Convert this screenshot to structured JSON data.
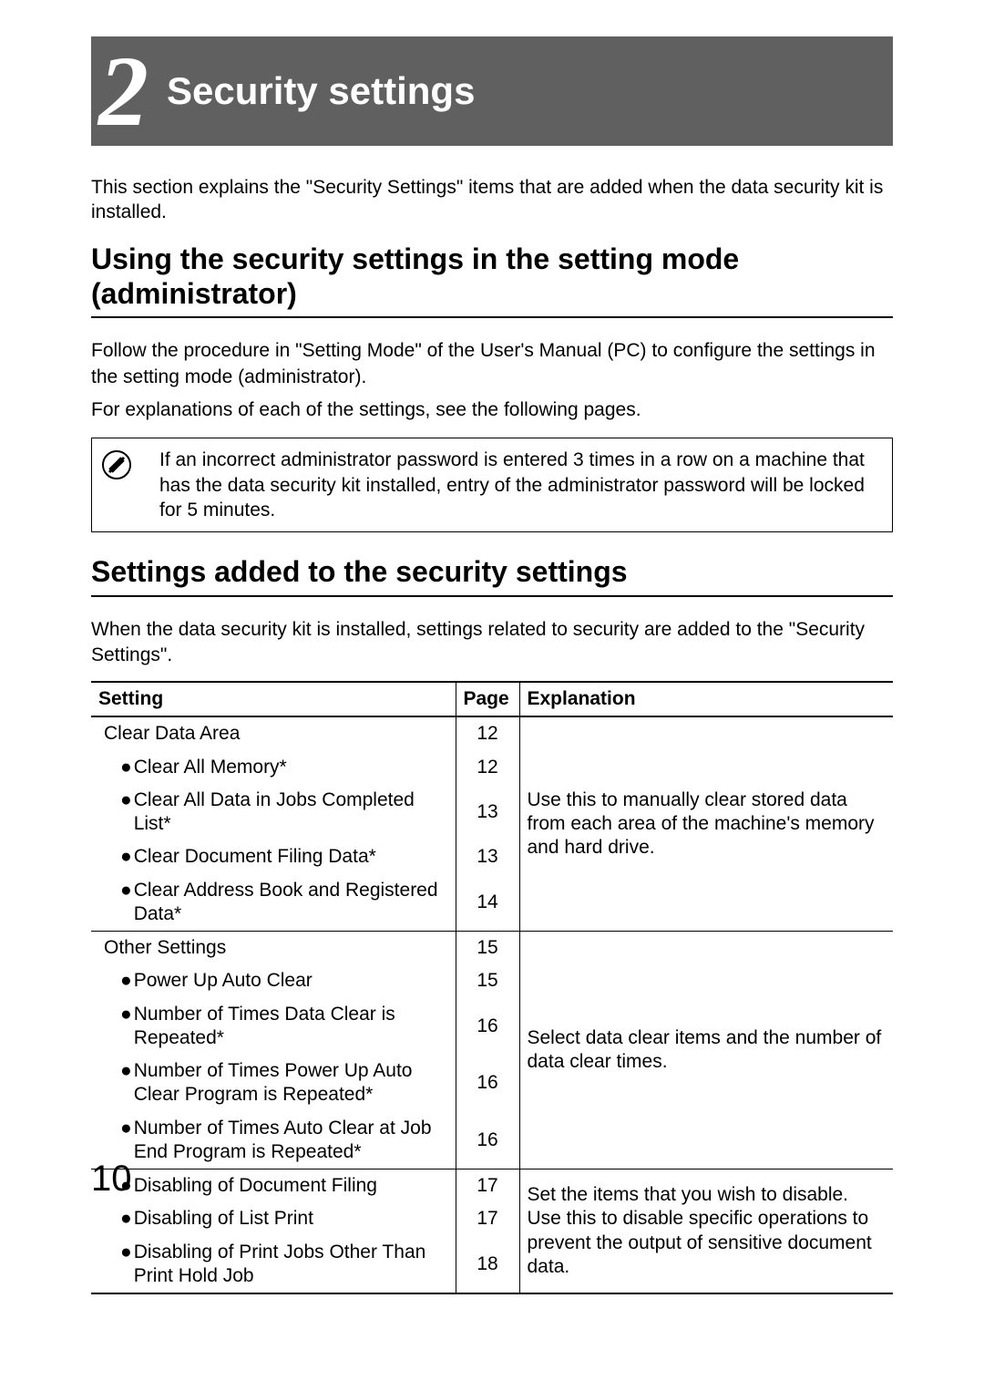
{
  "chapter": {
    "number": "2",
    "title": "Security settings"
  },
  "intro": "This section explains the \"Security Settings\" items that are added when the data security kit is installed.",
  "section1": {
    "heading": "Using the security settings in the setting mode (administrator)",
    "para1": "Follow the procedure in \"Setting Mode\" of the User's Manual (PC) to configure the settings in the setting mode (administrator).",
    "para2": "For explanations of each of the settings, see the following pages.",
    "note": "If an incorrect administrator password is entered 3 times in a row on a machine that has the data security kit installed, entry of the administrator password will be locked for 5 minutes."
  },
  "section2": {
    "heading": "Settings added to the security settings",
    "para": "When the data security kit is installed, settings related to security are added to the \"Security Settings\"."
  },
  "table": {
    "headers": {
      "setting": "Setting",
      "page": "Page",
      "explanation": "Explanation"
    },
    "groups": [
      {
        "explanation": "Use this to manually clear stored data from each area of the machine's memory and hard drive.",
        "rows": [
          {
            "label": "Clear Data Area",
            "page": "12",
            "indent": 0
          },
          {
            "label": "Clear All Memory*",
            "page": "12",
            "indent": 1
          },
          {
            "label": "Clear All Data in Jobs Completed List*",
            "page": "13",
            "indent": 1
          },
          {
            "label": "Clear Document Filing Data*",
            "page": "13",
            "indent": 1
          },
          {
            "label": "Clear Address Book and Registered Data*",
            "page": "14",
            "indent": 1
          }
        ]
      },
      {
        "explanation": "Select data clear items and the number of data clear times.",
        "rows": [
          {
            "label": "Other Settings",
            "page": "15",
            "indent": 0
          },
          {
            "label": "Power Up Auto Clear",
            "page": "15",
            "indent": 1
          },
          {
            "label": "Number of Times Data Clear is Repeated*",
            "page": "16",
            "indent": 1
          },
          {
            "label": "Number of Times Power Up Auto Clear Program is Repeated*",
            "page": "16",
            "indent": 1
          },
          {
            "label": "Number of Times Auto Clear at Job End Program is Repeated*",
            "page": "16",
            "indent": 1
          }
        ]
      },
      {
        "explanation": "Set the items that you wish to disable. Use this to disable specific operations to prevent the output of sensitive document data.",
        "rows": [
          {
            "label": "Disabling of Document Filing",
            "page": "17",
            "indent": 1
          },
          {
            "label": "Disabling of List Print",
            "page": "17",
            "indent": 1
          },
          {
            "label": "Disabling of Print Jobs Other Than Print Hold Job",
            "page": "18",
            "indent": 1
          }
        ]
      }
    ]
  },
  "page_number": "10"
}
